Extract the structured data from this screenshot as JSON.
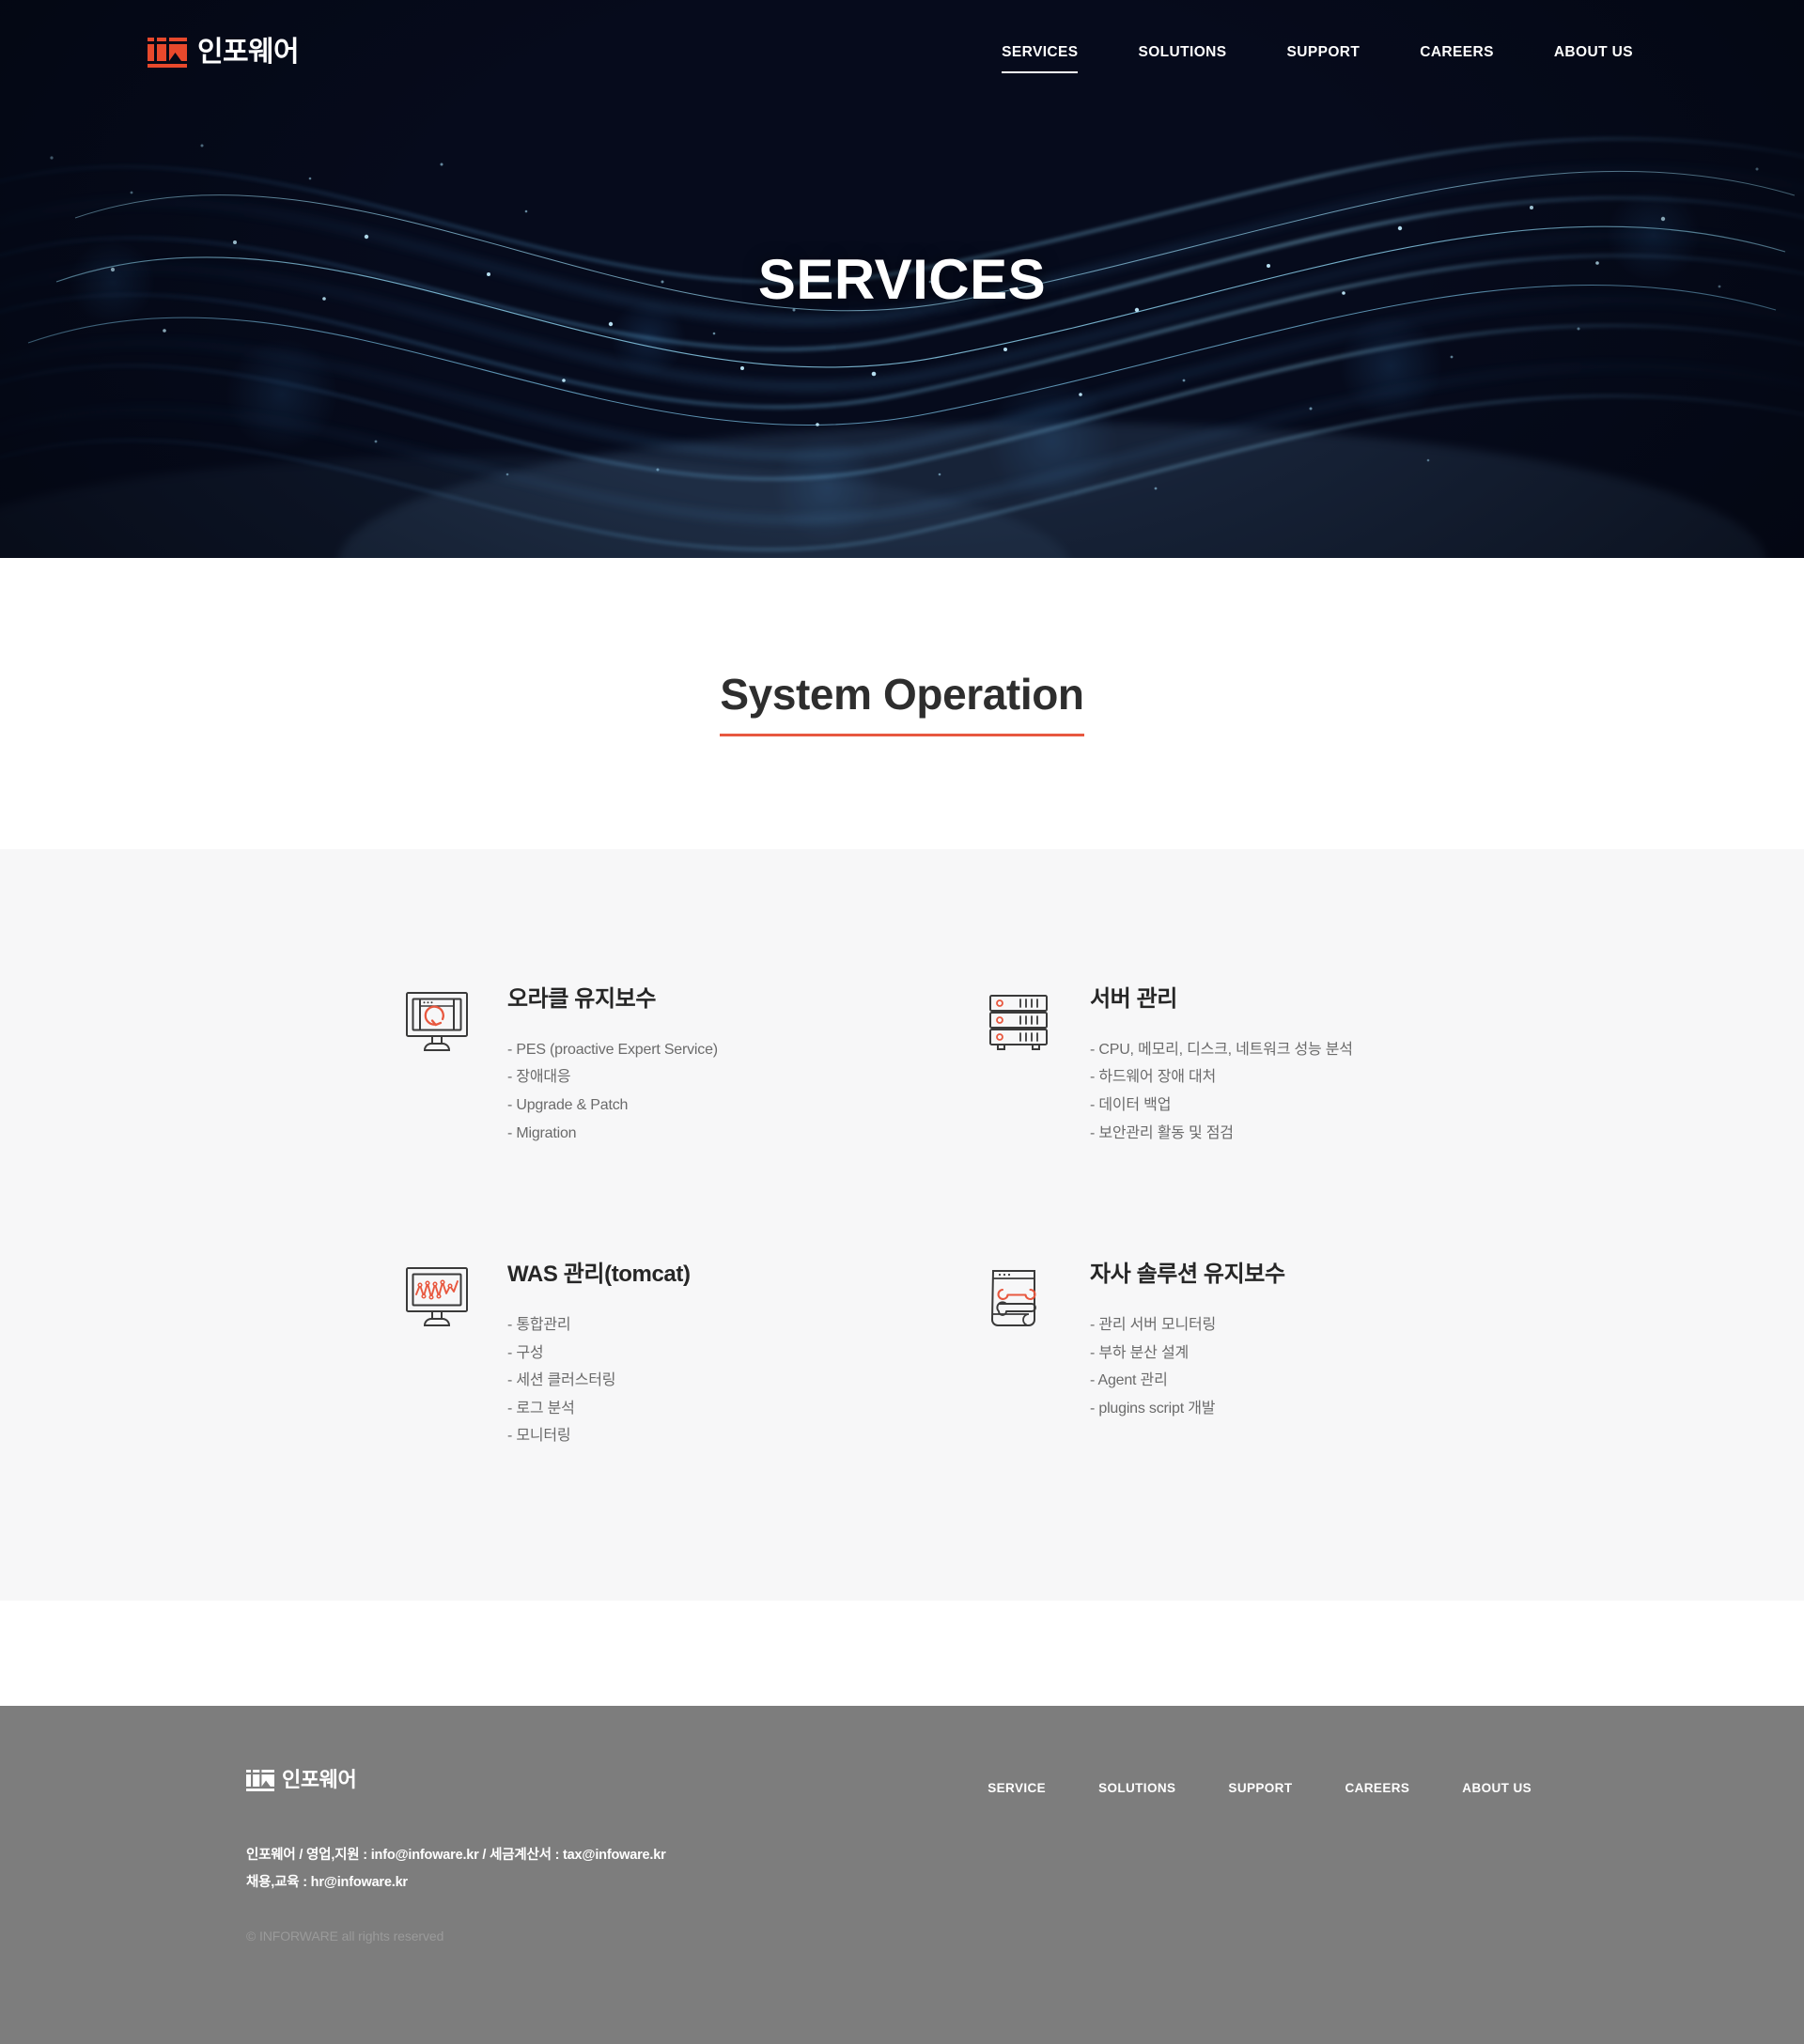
{
  "brand": {
    "name": "인포웨어",
    "logo_icon": "iw-logo-mark",
    "accent_color": "#e8583f"
  },
  "header": {
    "nav": [
      {
        "label": "SERVICES",
        "active": true
      },
      {
        "label": "SOLUTIONS",
        "active": false
      },
      {
        "label": "SUPPORT",
        "active": false
      },
      {
        "label": "CAREERS",
        "active": false
      },
      {
        "label": "ABOUT US",
        "active": false
      }
    ]
  },
  "hero": {
    "title": "SERVICES",
    "background": "dark-blue-network-particle-wave"
  },
  "section": {
    "title": "System Operation",
    "underline_color": "#e8583f"
  },
  "cards": [
    {
      "icon": "monitor-refresh-icon",
      "title": "오라클 유지보수",
      "items": [
        "- PES (proactive Expert Service)",
        "- 장애대응",
        "- Upgrade & Patch",
        "- Migration"
      ]
    },
    {
      "icon": "server-rack-icon",
      "title": "서버 관리",
      "items": [
        "- CPU, 메모리, 디스크, 네트워크 성능 분석",
        "- 하드웨어 장애 대처",
        "- 데이터 백업",
        "- 보안관리 활동 및 점검"
      ]
    },
    {
      "icon": "monitor-chart-icon",
      "title": "WAS 관리(tomcat)",
      "items": [
        "- 통합관리",
        "- 구성",
        "- 세션 클러스터링",
        "- 로그 분석",
        "- 모니터링"
      ]
    },
    {
      "icon": "document-wrench-icon",
      "title": "자사 솔루션 유지보수",
      "items": [
        "- 관리 서버 모니터링",
        "- 부하 분산 설계",
        "- Agent 관리",
        "- plugins script 개발"
      ]
    }
  ],
  "footer": {
    "brand_name": "인포웨어",
    "contact_line_1": "인포웨어 / 영업,지원 : info@infoware.kr / 세금계산서 : tax@infoware.kr",
    "contact_line_2": "채용,교육 : hr@infoware.kr",
    "copyright": "© INFORWARE all rights reserved",
    "nav": [
      {
        "label": "SERVICE"
      },
      {
        "label": "SOLUTIONS"
      },
      {
        "label": "SUPPORT"
      },
      {
        "label": "CAREERS"
      },
      {
        "label": "ABOUT US"
      }
    ]
  }
}
